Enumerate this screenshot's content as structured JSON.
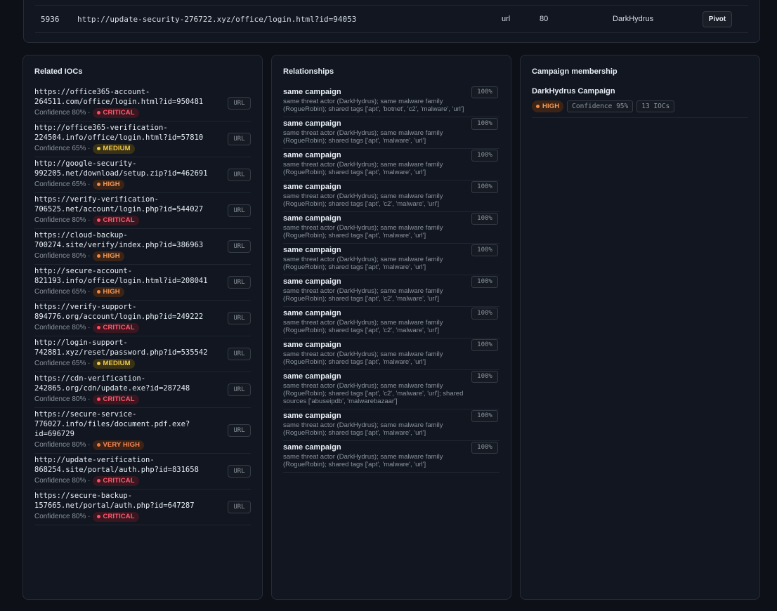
{
  "top_row": {
    "id": "5936",
    "value": "http://update-security-276722.xyz/office/login.html?id=94053",
    "type": "url",
    "score": "80",
    "actor": "DarkHydrus",
    "pivot_label": "Pivot"
  },
  "related": {
    "title": "Related IOCs",
    "confidence_prefix": "Confidence",
    "items": [
      {
        "url": "https://office365-account-\n264511.com/office/login.html?id=950481",
        "confidence": "80%",
        "severity": "CRITICAL",
        "sev": "critical",
        "type": "URL"
      },
      {
        "url": "http://office365-verification-\n224504.info/office/login.html?id=57810",
        "confidence": "65%",
        "severity": "MEDIUM",
        "sev": "medium",
        "type": "URL"
      },
      {
        "url": "http://google-security-\n992205.net/download/setup.zip?id=462691",
        "confidence": "65%",
        "severity": "HIGH",
        "sev": "high",
        "type": "URL"
      },
      {
        "url": "https://verify-verification-\n706525.net/account/login.php?id=544027",
        "confidence": "80%",
        "severity": "CRITICAL",
        "sev": "critical",
        "type": "URL"
      },
      {
        "url": "https://cloud-backup-\n700274.site/verify/index.php?id=386963",
        "confidence": "80%",
        "severity": "HIGH",
        "sev": "high",
        "type": "URL"
      },
      {
        "url": "http://secure-account-\n821193.info/office/login.html?id=208041",
        "confidence": "65%",
        "severity": "HIGH",
        "sev": "high",
        "type": "URL"
      },
      {
        "url": "https://verify-support-\n894776.org/account/login.php?id=249222",
        "confidence": "80%",
        "severity": "CRITICAL",
        "sev": "critical",
        "type": "URL"
      },
      {
        "url": "http://login-support-\n742881.xyz/reset/password.php?id=535542",
        "confidence": "65%",
        "severity": "MEDIUM",
        "sev": "medium",
        "type": "URL"
      },
      {
        "url": "https://cdn-verification-\n242865.org/cdn/update.exe?id=287248",
        "confidence": "80%",
        "severity": "CRITICAL",
        "sev": "critical",
        "type": "URL"
      },
      {
        "url": "https://secure-service-\n776027.info/files/document.pdf.exe?\nid=696729",
        "confidence": "80%",
        "severity": "VERY HIGH",
        "sev": "veryhigh",
        "type": "URL"
      },
      {
        "url": "http://update-verification-\n868254.site/portal/auth.php?id=831658",
        "confidence": "80%",
        "severity": "CRITICAL",
        "sev": "critical",
        "type": "URL"
      },
      {
        "url": "https://secure-backup-\n157665.net/portal/auth.php?id=647287",
        "confidence": "80%",
        "severity": "CRITICAL",
        "sev": "critical",
        "type": "URL"
      }
    ]
  },
  "relationships": {
    "title": "Relationships",
    "items": [
      {
        "title": "same campaign",
        "pct": "100%",
        "desc": "same threat actor (DarkHydrus); same malware family (RogueRobin); shared tags ['apt', 'botnet', 'c2', 'malware', 'url']"
      },
      {
        "title": "same campaign",
        "pct": "100%",
        "desc": "same threat actor (DarkHydrus); same malware family (RogueRobin); shared tags ['apt', 'malware', 'url']"
      },
      {
        "title": "same campaign",
        "pct": "100%",
        "desc": "same threat actor (DarkHydrus); same malware family (RogueRobin); shared tags ['apt', 'malware', 'url']"
      },
      {
        "title": "same campaign",
        "pct": "100%",
        "desc": "same threat actor (DarkHydrus); same malware family (RogueRobin); shared tags ['apt', 'c2', 'malware', 'url']"
      },
      {
        "title": "same campaign",
        "pct": "100%",
        "desc": "same threat actor (DarkHydrus); same malware family (RogueRobin); shared tags ['apt', 'malware', 'url']"
      },
      {
        "title": "same campaign",
        "pct": "100%",
        "desc": "same threat actor (DarkHydrus); same malware family (RogueRobin); shared tags ['apt', 'malware', 'url']"
      },
      {
        "title": "same campaign",
        "pct": "100%",
        "desc": "same threat actor (DarkHydrus); same malware family (RogueRobin); shared tags ['apt', 'c2', 'malware', 'url']"
      },
      {
        "title": "same campaign",
        "pct": "100%",
        "desc": "same threat actor (DarkHydrus); same malware family (RogueRobin); shared tags ['apt', 'c2', 'malware', 'url']"
      },
      {
        "title": "same campaign",
        "pct": "100%",
        "desc": "same threat actor (DarkHydrus); same malware family (RogueRobin); shared tags ['apt', 'malware', 'url']"
      },
      {
        "title": "same campaign",
        "pct": "100%",
        "desc": "same threat actor (DarkHydrus); same malware family (RogueRobin); shared tags ['apt', 'c2', 'malware', 'url']; shared sources ['abuseipdb', 'malwarebazaar']"
      },
      {
        "title": "same campaign",
        "pct": "100%",
        "desc": "same threat actor (DarkHydrus); same malware family (RogueRobin); shared tags ['apt', 'malware', 'url']"
      },
      {
        "title": "same campaign",
        "pct": "100%",
        "desc": "same threat actor (DarkHydrus); same malware family (RogueRobin); shared tags ['apt', 'malware', 'url']"
      }
    ]
  },
  "campaign": {
    "title": "Campaign membership",
    "name": "DarkHydrus Campaign",
    "severity": "HIGH",
    "confidence": "Confidence 95%",
    "ioc_count": "13 IOCs"
  },
  "colors": {
    "background": "#0d1117",
    "panel": "#111620",
    "critical": "#ff4d63",
    "high": "#f08a44",
    "medium": "#f2c94c"
  }
}
